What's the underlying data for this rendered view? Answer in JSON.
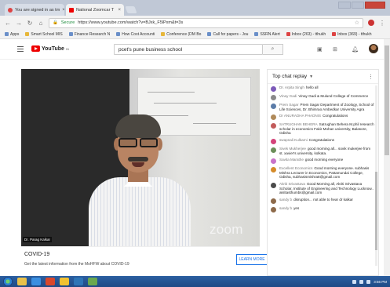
{
  "browser": {
    "tabs": [
      {
        "label": "You are signed in as tm",
        "icon": "mail-icon"
      },
      {
        "label": "National Zoomcar T",
        "icon": "youtube-icon"
      }
    ],
    "url": {
      "secure_label": "Secure",
      "address": "https://www.youtube.com/watch?v=BJxk_F5lPxm&t=3s"
    },
    "bookmarks": [
      "Apps",
      "Smart School MIS",
      "Finance Research N",
      "How Cost Accounti",
      "Conference (DM Bo",
      "Call for papers - Jou",
      "SSRN Alert",
      "Inbox (263) - tthukh",
      "Inbox (369) - tthukh"
    ]
  },
  "youtube": {
    "logo_text": "YouTube",
    "logo_region": "IN",
    "search_value": "pcet's pune business school"
  },
  "video": {
    "watermark": "zoom",
    "speaker_tag": "Dr. Parag Kalkar"
  },
  "info_panel": {
    "title": "COVID-19",
    "subtitle": "Get the latest information from the MoHFW about COVID-19",
    "button": "LEARN MORE"
  },
  "chat": {
    "header": "Top chat replay",
    "messages": [
      {
        "author": "Dr. Arpita Singh",
        "text": "hello all",
        "color": "#7c5ab8"
      },
      {
        "author": "Vinay Gadi",
        "text": "Vinay Gadi & Mulund College of Commerce",
        "color": "#8a8a8a"
      },
      {
        "author": "Prem Sagar",
        "text": "Prem Sagar Department of Zoology, School of Life Sciences, Dr. Bhimrao Ambedkar University Agra",
        "color": "#5b7ca8"
      },
      {
        "author": "Dr ANURADHA PHADNIS",
        "text": "Congratulations",
        "color": "#b08a5a"
      },
      {
        "author": "SATRUGHAN BEHERA",
        "text": "Satrughan Behera M.phil research scholar in economics Fakir Mohan university, Balasore, Odisha",
        "color": "#c25b5b"
      },
      {
        "author": "swapnali Kulkarni",
        "text": "Congratulations",
        "color": "#d4447a"
      },
      {
        "author": "Sivek Mukherjee",
        "text": "good morning all... sovik mukerjee from st. xavier's university, kolkata.",
        "color": "#6b8e5a"
      },
      {
        "author": "Savita Marathe",
        "text": "good morning everyone",
        "color": "#c873c9"
      },
      {
        "author": "Excellent Economics",
        "text": "Good morning everyone. subhasis Mishra Lecturer in Economics, Pattamundai College, Odisha, subhasismishra8@gmail.com",
        "color": "#d58b2a"
      },
      {
        "author": "Akriti Srivastava",
        "text": "Good Morning all, Akriti Srivastava Scholar, Institute of Engineering and Technology Lucknow.. akritasthumbs@gmail.com",
        "color": "#4a4a4a"
      },
      {
        "author": "sandy b",
        "text": "disruption... not able to hear dr kalkar",
        "color": "#8d6a4a"
      },
      {
        "author": "sandy b",
        "text": "yes",
        "color": "#8d6a4a"
      }
    ]
  },
  "taskbar": {
    "tray_time": "3:56 PM"
  }
}
